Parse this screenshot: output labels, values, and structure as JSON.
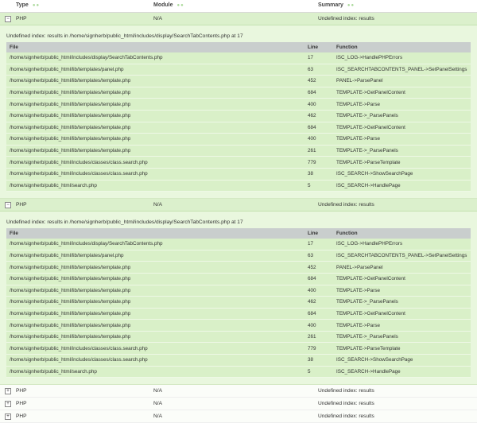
{
  "header": {
    "type_label": "Type",
    "module_label": "Module",
    "summary_label": "Summary"
  },
  "errors": [
    {
      "type": "PHP",
      "module": "N/A",
      "summary": "Undefined index: results",
      "message": "Undefined index: results in /home/signherb/public_html/includes/display/SearchTabContents.php at 17",
      "trace_headers": {
        "file": "File",
        "line": "Line",
        "function": "Function"
      },
      "trace": [
        {
          "file": "/home/signherb/public_html/includes/display/SearchTabContents.php",
          "line": "17",
          "function": "ISC_LOG->HandlePHPErrors"
        },
        {
          "file": "/home/signherb/public_html/lib/templates/panel.php",
          "line": "63",
          "function": "ISC_SEARCHTABCONTENTS_PANEL->SetPanelSettings"
        },
        {
          "file": "/home/signherb/public_html/lib/templates/template.php",
          "line": "452",
          "function": "PANEL->ParsePanel"
        },
        {
          "file": "/home/signherb/public_html/lib/templates/template.php",
          "line": "684",
          "function": "TEMPLATE->GetPanelContent"
        },
        {
          "file": "/home/signherb/public_html/lib/templates/template.php",
          "line": "400",
          "function": "TEMPLATE->Parse"
        },
        {
          "file": "/home/signherb/public_html/lib/templates/template.php",
          "line": "462",
          "function": "TEMPLATE->_ParsePanels"
        },
        {
          "file": "/home/signherb/public_html/lib/templates/template.php",
          "line": "684",
          "function": "TEMPLATE->GetPanelContent"
        },
        {
          "file": "/home/signherb/public_html/lib/templates/template.php",
          "line": "400",
          "function": "TEMPLATE->Parse"
        },
        {
          "file": "/home/signherb/public_html/lib/templates/template.php",
          "line": "261",
          "function": "TEMPLATE->_ParsePanels"
        },
        {
          "file": "/home/signherb/public_html/includes/classes/class.search.php",
          "line": "779",
          "function": "TEMPLATE->ParseTemplate"
        },
        {
          "file": "/home/signherb/public_html/includes/classes/class.search.php",
          "line": "38",
          "function": "ISC_SEARCH->ShowSearchPage"
        },
        {
          "file": "/home/signherb/public_html/search.php",
          "line": "5",
          "function": "ISC_SEARCH->HandlePage"
        }
      ]
    },
    {
      "type": "PHP",
      "module": "N/A",
      "summary": "Undefined index: results",
      "message": "Undefined index: results in /home/signherb/public_html/includes/display/SearchTabContents.php at 17",
      "trace_headers": {
        "file": "File",
        "line": "Line",
        "function": "Function"
      },
      "trace": [
        {
          "file": "/home/signherb/public_html/includes/display/SearchTabContents.php",
          "line": "17",
          "function": "ISC_LOG->HandlePHPErrors"
        },
        {
          "file": "/home/signherb/public_html/lib/templates/panel.php",
          "line": "63",
          "function": "ISC_SEARCHTABCONTENTS_PANEL->SetPanelSettings"
        },
        {
          "file": "/home/signherb/public_html/lib/templates/template.php",
          "line": "452",
          "function": "PANEL->ParsePanel"
        },
        {
          "file": "/home/signherb/public_html/lib/templates/template.php",
          "line": "684",
          "function": "TEMPLATE->GetPanelContent"
        },
        {
          "file": "/home/signherb/public_html/lib/templates/template.php",
          "line": "400",
          "function": "TEMPLATE->Parse"
        },
        {
          "file": "/home/signherb/public_html/lib/templates/template.php",
          "line": "462",
          "function": "TEMPLATE->_ParsePanels"
        },
        {
          "file": "/home/signherb/public_html/lib/templates/template.php",
          "line": "684",
          "function": "TEMPLATE->GetPanelContent"
        },
        {
          "file": "/home/signherb/public_html/lib/templates/template.php",
          "line": "400",
          "function": "TEMPLATE->Parse"
        },
        {
          "file": "/home/signherb/public_html/lib/templates/template.php",
          "line": "261",
          "function": "TEMPLATE->_ParsePanels"
        },
        {
          "file": "/home/signherb/public_html/includes/classes/class.search.php",
          "line": "779",
          "function": "TEMPLATE->ParseTemplate"
        },
        {
          "file": "/home/signherb/public_html/includes/classes/class.search.php",
          "line": "38",
          "function": "ISC_SEARCH->ShowSearchPage"
        },
        {
          "file": "/home/signherb/public_html/search.php",
          "line": "5",
          "function": "ISC_SEARCH->HandlePage"
        }
      ]
    },
    {
      "type": "PHP",
      "module": "N/A",
      "summary": "Undefined index: results"
    },
    {
      "type": "PHP",
      "module": "N/A",
      "summary": "Undefined index: results"
    },
    {
      "type": "PHP",
      "module": "N/A",
      "summary": "Undefined index: results"
    }
  ],
  "icons": {
    "expanded": "⊟ collapse-icon",
    "collapsed": "⊞ expand-icon"
  },
  "colors": {
    "open_row": "#dbf0cc",
    "detail_bg": "#e9f7de",
    "trace_row": "#d9f0c8",
    "trace_header": "#c9cecd"
  }
}
